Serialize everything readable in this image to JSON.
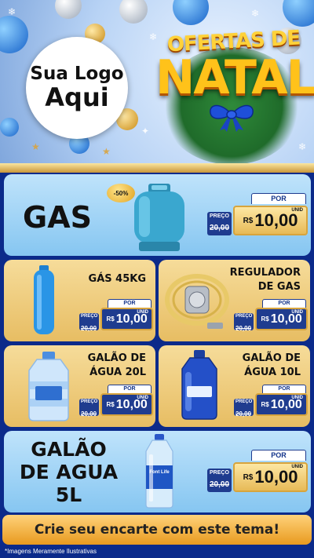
{
  "header": {
    "logo_line1": "Sua Logo",
    "logo_line2": "Aqui",
    "promo_title_line1": "OFERTAS DE",
    "promo_title_line2": "NATAL"
  },
  "products": [
    {
      "name": "GAS",
      "badge": "-50%",
      "por_label": "POR",
      "preco_label": "PREÇO",
      "old_price": "20,00",
      "currency": "R$",
      "new_price": "10,00",
      "unit": "UNID"
    },
    {
      "name": "GÁS 45KG",
      "por_label": "POR",
      "preco_label": "PREÇO",
      "old_price": "20,00",
      "currency": "R$",
      "new_price": "10,00",
      "unit": "UNID"
    },
    {
      "name_line1": "REGULADOR",
      "name_line2": "DE GAS",
      "por_label": "POR",
      "preco_label": "PREÇO",
      "old_price": "20,00",
      "currency": "R$",
      "new_price": "10,00",
      "unit": "UNID"
    },
    {
      "name_line1": "GALÃO DE",
      "name_line2": "ÁGUA 20L",
      "por_label": "POR",
      "preco_label": "PREÇO",
      "old_price": "20,00",
      "currency": "R$",
      "new_price": "10,00",
      "unit": "UNID"
    },
    {
      "name_line1": "GALÃO DE",
      "name_line2": "ÁGUA 10L",
      "por_label": "POR",
      "preco_label": "PREÇO",
      "old_price": "20,00",
      "currency": "R$",
      "new_price": "10,00",
      "unit": "UNID"
    },
    {
      "name_line1": "GALÃO",
      "name_line2": "DE AGUA",
      "name_line3": "5L",
      "por_label": "POR",
      "preco_label": "PREÇO",
      "old_price": "20,00",
      "currency": "R$",
      "new_price": "10,00",
      "unit": "UNID",
      "bottle_brand": "Font Life"
    }
  ],
  "footer": {
    "cta": "Crie seu encarte com este tema!",
    "disclaimer": "*Imagens Meramente Ilustrativas"
  },
  "colors": {
    "background": "#0b2a8a",
    "card_blue": "#9fd3f5",
    "card_tan": "#eec97a",
    "price_blue": "#1f3c8f",
    "gold": "#d7a43d",
    "cta_orange": "#f1a935"
  },
  "icons": [
    "snowflake-icon",
    "christmas-bauble-icon",
    "ribbon-bow-icon",
    "gas-cylinder-icon",
    "water-jug-icon",
    "gas-regulator-icon",
    "water-bottle-icon"
  ]
}
